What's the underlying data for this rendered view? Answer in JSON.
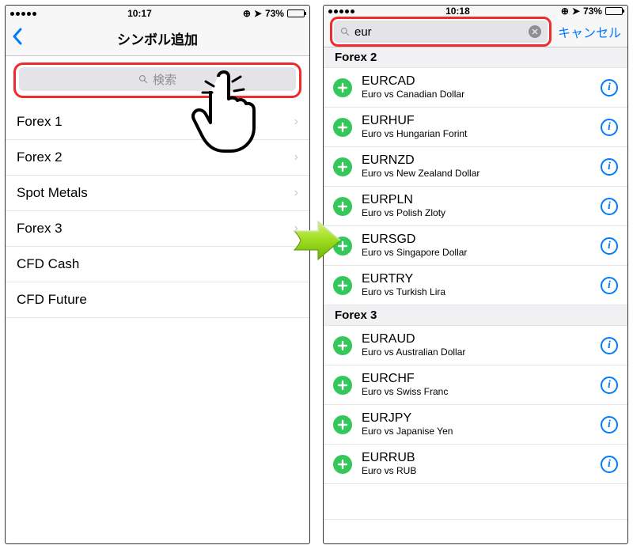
{
  "status": {
    "time_left": "10:17",
    "time_right": "10:18",
    "battery_pct": "73%"
  },
  "left": {
    "nav_title": "シンボル追加",
    "search_placeholder": "検索",
    "categories": [
      {
        "label": "Forex 1",
        "disclosure": true
      },
      {
        "label": "Forex 2",
        "disclosure": true
      },
      {
        "label": "Spot Metals",
        "disclosure": true
      },
      {
        "label": "Forex 3",
        "disclosure": true
      },
      {
        "label": "CFD Cash",
        "disclosure": false
      },
      {
        "label": "CFD Future",
        "disclosure": false
      }
    ]
  },
  "right": {
    "search_query": "eur",
    "cancel_label": "キャンセル",
    "sections": [
      {
        "title": "Forex 2",
        "items": [
          {
            "code": "EURCAD",
            "desc": "Euro vs Canadian Dollar"
          },
          {
            "code": "EURHUF",
            "desc": "Euro vs Hungarian Forint"
          },
          {
            "code": "EURNZD",
            "desc": "Euro vs New Zealand Dollar"
          },
          {
            "code": "EURPLN",
            "desc": "Euro vs Polish Zloty"
          },
          {
            "code": "EURSGD",
            "desc": "Euro vs Singapore Dollar"
          },
          {
            "code": "EURTRY",
            "desc": "Euro vs Turkish Lira"
          }
        ]
      },
      {
        "title": "Forex 3",
        "items": [
          {
            "code": "EURAUD",
            "desc": "Euro vs Australian Dollar"
          },
          {
            "code": "EURCHF",
            "desc": "Euro vs Swiss Franc"
          },
          {
            "code": "EURJPY",
            "desc": "Euro vs Japanise Yen"
          },
          {
            "code": "EURRUB",
            "desc": "Euro vs RUB"
          }
        ]
      }
    ]
  }
}
